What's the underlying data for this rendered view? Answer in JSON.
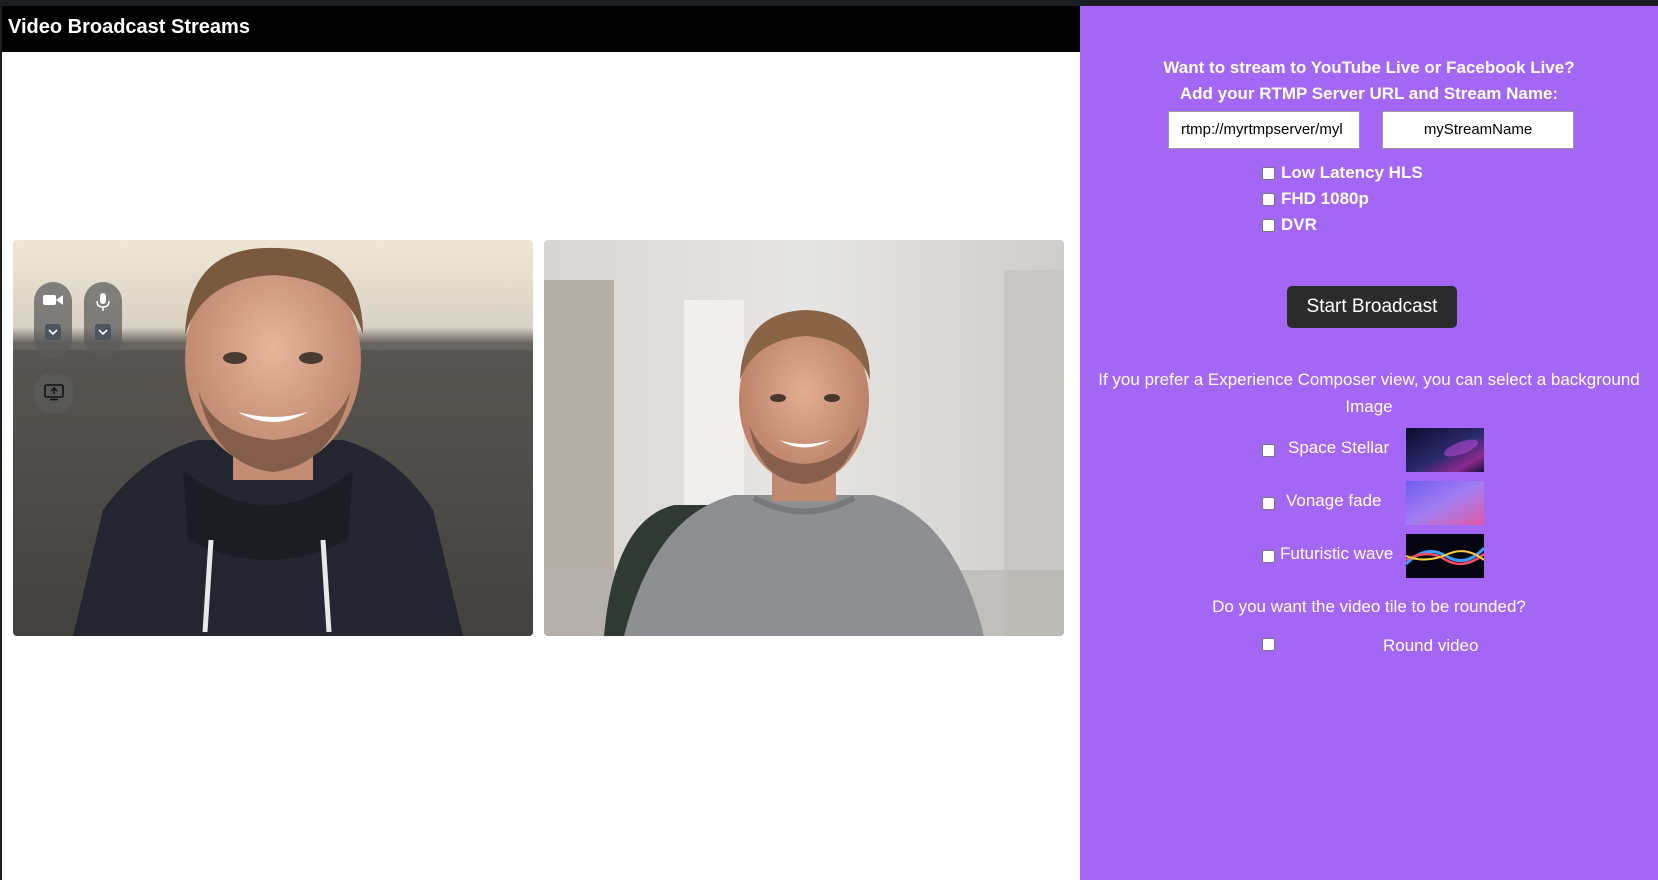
{
  "header": {
    "title": "Video Broadcast Streams"
  },
  "video_tiles": [
    {
      "name": "local-camera"
    },
    {
      "name": "remote-camera"
    }
  ],
  "controls": {
    "camera_icon": "video-camera-icon",
    "mic_icon": "microphone-icon",
    "screen_icon": "screen-share-icon"
  },
  "broadcast": {
    "prompt_line1": "Want to stream to YouTube Live or Facebook Live?",
    "prompt_line2": "Add your RTMP Server URL and Stream Name:",
    "rtmp_url_value": "rtmp://myrtmpserver/myl",
    "stream_name_value": "myStreamName",
    "options": [
      {
        "label": "Low Latency HLS",
        "checked": false
      },
      {
        "label": "FHD 1080p",
        "checked": false
      },
      {
        "label": "DVR",
        "checked": false
      }
    ],
    "start_label": "Start Broadcast"
  },
  "composer": {
    "prompt": "If you prefer a Experience Composer view, you can select a background Image",
    "backgrounds": [
      {
        "label": "Space Stellar",
        "checked": false
      },
      {
        "label": "Vonage fade",
        "checked": false
      },
      {
        "label": "Futuristic wave",
        "checked": false
      }
    ]
  },
  "rounded": {
    "prompt": "Do you want the video tile to be rounded?",
    "label": "Round video",
    "checked": false
  },
  "colors": {
    "panel_bg": "#a366f5",
    "header_bg": "#000000",
    "button_bg": "#2b2b2b"
  }
}
